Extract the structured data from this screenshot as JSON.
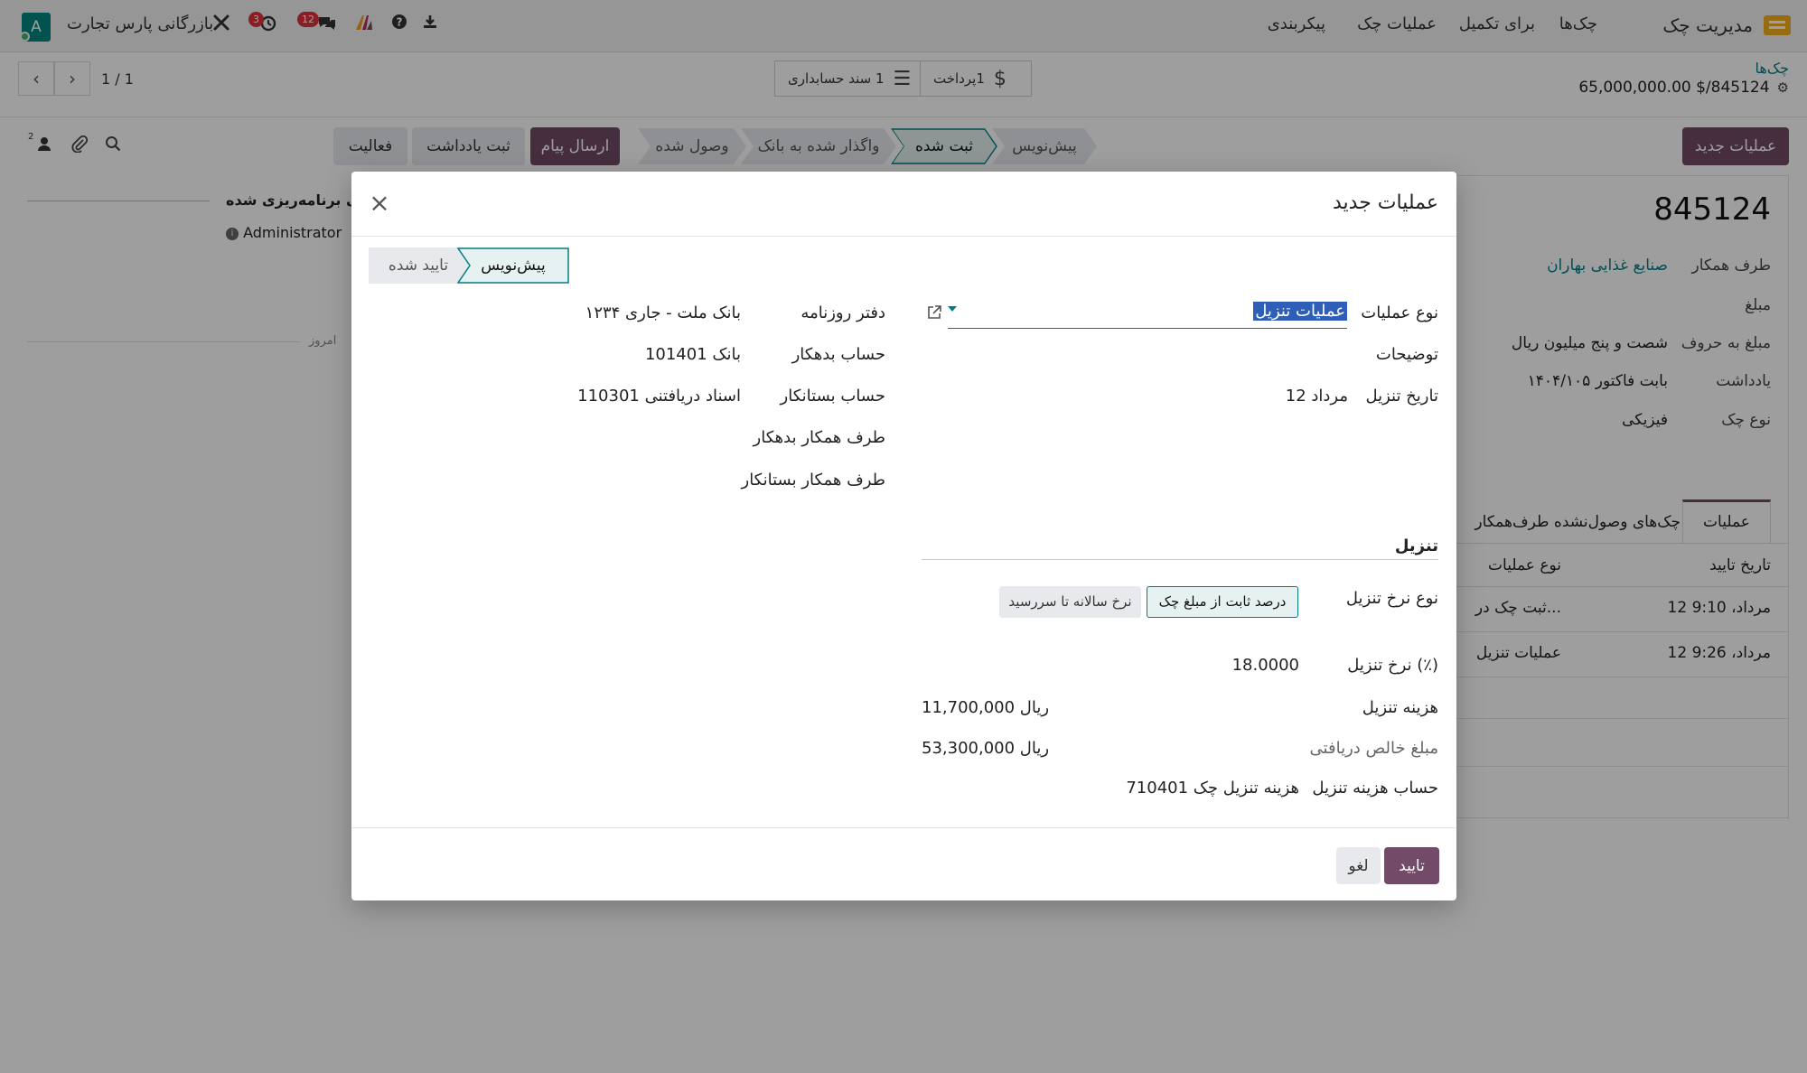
{
  "navbar": {
    "brand": "مدیریت چک",
    "menu": [
      "چک‌ها",
      "برای تکمیل",
      "عملیات چک",
      "پیکربندی"
    ],
    "company": "بازرگانی پارس تجارت",
    "chat_badge": "12",
    "activity_badge": "3",
    "avatar_letter": "A",
    "icons": [
      "app-icon",
      "download-icon",
      "help-icon",
      "ai-icon",
      "chat-icon",
      "activity-clock-icon",
      "debug-tools-icon"
    ]
  },
  "control": {
    "breadcrumb_parent": "چک‌ها",
    "record_title": "65,000,000.00 $/845124",
    "pager": "1 / 1",
    "smart_buttons": [
      {
        "label": "پرداخت",
        "count": "1",
        "icon": "dollar-icon"
      },
      {
        "label": "سند حسابداری",
        "count": "1",
        "icon": "list-icon"
      }
    ]
  },
  "actions": {
    "new_operation": "عملیات جدید",
    "stages": [
      "پیش‌نویس",
      "ثبت شده",
      "واگذار شده به بانک",
      "وصول شده"
    ],
    "active_stage": "ثبت شده",
    "chatter_buttons": {
      "send": "ارسال پیام",
      "note": "ثبت یادداشت",
      "activity": "فعالیت"
    },
    "follower_count": "2"
  },
  "background_form": {
    "check_number": "845124",
    "fields": [
      {
        "label": "طرف همکار",
        "value": "صنایع غذایی بهاران"
      },
      {
        "label": "مبلغ",
        "value": ""
      },
      {
        "label": "مبلغ به حروف",
        "value": "شصت و پنج میلیون ریال"
      },
      {
        "label": "یادداشت",
        "value": "بابت فاکتور ۱۴۰۴/۱۰۵"
      },
      {
        "label": "نوع چک",
        "value": "فیزیکی"
      }
    ],
    "tabs": [
      "عملیات",
      "چک‌های وصول‌نشده طرف‌همکار"
    ],
    "table_headers": [
      "تاریخ تایید",
      "نوع عملیات"
    ],
    "table_rows": [
      {
        "date": "12 مرداد، 9:10",
        "type": "ثبت چک در..."
      },
      {
        "date": "12 مرداد، 9:26",
        "type": "عملیات تنزیل"
      }
    ],
    "chatter_title": "های برنامه‌ریزی شده",
    "chatter_user": "Administrator",
    "today_label": "امروز"
  },
  "dialog": {
    "title": "عملیات جدید",
    "stages": [
      "پیش‌نویس",
      "تایید شده"
    ],
    "active_stage": "پیش‌نویس",
    "operation_type_label": "نوع عملیات",
    "operation_type_value": "عملیات تنزیل",
    "description_label": "توضیحات",
    "discount_date_label": "تاریخ تنزیل",
    "discount_date_value": "12 مرداد",
    "journal_label": "دفتر روزنامه",
    "journal_value": "بانک ملت - جاری ۱۲۳۴",
    "debit_account_label": "حساب بدهکار",
    "debit_account_value": "101401 بانک",
    "credit_account_label": "حساب بستانکار",
    "credit_account_value": "110301 اسناد دریافتنی",
    "debit_partner_label": "طرف همکار بدهکار",
    "credit_partner_label": "طرف همکار بستانکار",
    "section_title": "تنزیل",
    "rate_type_label": "نوع نرخ تنزیل",
    "rate_type_options": [
      "درصد ثابت از مبلغ چک",
      "نرخ سالانه تا سررسید"
    ],
    "rate_type_selected": "درصد ثابت از مبلغ چک",
    "rate_label": "نرخ تنزیل (٪)",
    "rate_value": "18.0000",
    "cost_label": "هزینه تنزیل",
    "cost_value": "11,700,000 ریال",
    "net_label": "مبلغ خالص دریافتی",
    "net_value": "53,300,000 ریال",
    "cost_account_label": "حساب هزینه تنزیل",
    "cost_account_value": "710401 هزینه تنزیل چک",
    "confirm": "تایید",
    "cancel": "لغو"
  }
}
